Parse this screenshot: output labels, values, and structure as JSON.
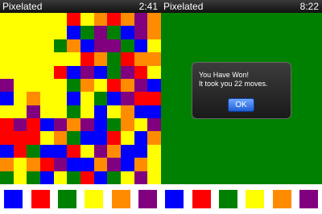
{
  "left_screen": {
    "title": "Pixelated",
    "time": "2:41"
  },
  "right_screen": {
    "title": "Pixelated",
    "time": "8:22",
    "dialog": {
      "line1": "You Have Won!",
      "line2": "It took you 22 moves.",
      "ok_label": "OK"
    }
  },
  "colors": {
    "Y": "#ffff00",
    "B": "#0000ff",
    "R": "#ff0000",
    "G": "#008000",
    "O": "#ff8c00",
    "P": "#800080"
  },
  "board": {
    "rows": 13,
    "cols": 12,
    "grid": [
      "YYYYYRYOROPO",
      "YYYYYBGPGBPO",
      "YYYYGOBPPGBY",
      "YYYYYYROGROO",
      "YYYYRBPBGPRY",
      "PYYYYGOYROPB",
      "BYOYYBYGBPRR",
      "YYPYYGYBYOBB",
      "RPRBPOPBGOYP",
      "RRRYOGBBRYBO",
      "BRGBBRYPOBBY",
      "OYORPBBOPBOY",
      "GYGBYGRBGYPY"
    ]
  },
  "solved_color": "#008000",
  "palette": {
    "swatches": [
      "B",
      "R",
      "G",
      "Y",
      "O",
      "P",
      "B",
      "R",
      "G",
      "Y",
      "O",
      "P"
    ]
  }
}
